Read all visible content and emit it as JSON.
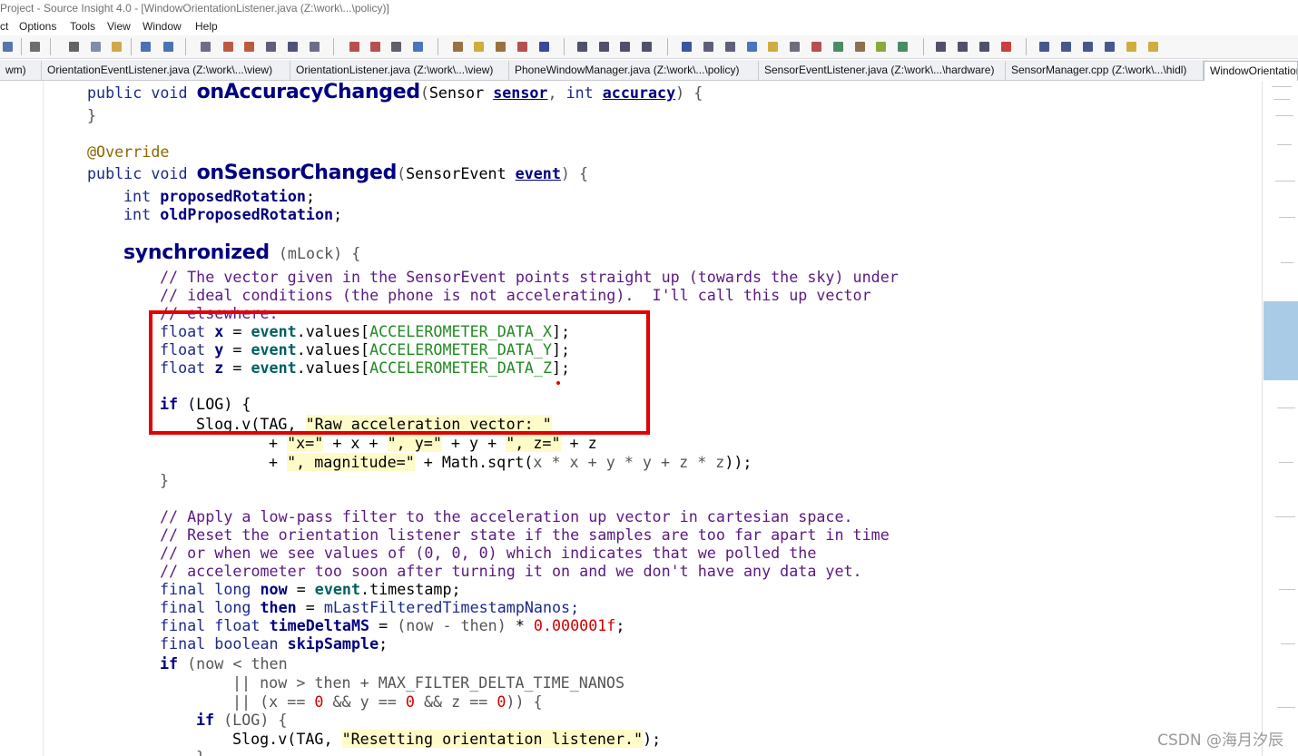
{
  "window": {
    "title": "Project - Source Insight 4.0 - [WindowOrientationListener.java (Z:\\work\\...\\policy)]"
  },
  "menu": [
    "ct",
    "Options",
    "Tools",
    "View",
    "Window",
    "Help"
  ],
  "tabs": [
    "wm)",
    "OrientationEventListener.java (Z:\\work\\...\\view)",
    "OrientationListener.java (Z:\\work\\...\\view)",
    "PhoneWindowManager.java (Z:\\work\\...\\policy)",
    "SensorEventListener.java (Z:\\work\\...\\hardware)",
    "SensorManager.cpp (Z:\\work\\...\\hidl)",
    "WindowOrientationListener.java"
  ],
  "code": {
    "l1": {
      "pub": "public void",
      "name": "onAccuracyChanged",
      "open": "(",
      "t1": "Sensor",
      "a1": "sensor",
      "comma": ",",
      "t2": "int",
      "a2": "accuracy",
      "close": ") {"
    },
    "l2": "}",
    "l3": "@Override",
    "l4": {
      "pub": "public void",
      "name": "onSensorChanged",
      "open": "(",
      "t1": "SensorEvent",
      "a1": "event",
      "close": ") {"
    },
    "l5": {
      "t": "int",
      "v": "proposedRotation",
      "s": ";"
    },
    "l6": {
      "t": "int",
      "v": "oldProposedRotation",
      "s": ";"
    },
    "l7": {
      "kw": "synchronized",
      "rest": "(mLock) {"
    },
    "c1": "// The vector given in the SensorEvent points straight up (towards the sky) under",
    "c2": "// ideal conditions (the phone is not accelerating).  I'll call this up vector",
    "c3": "// elsewhere.",
    "fx": {
      "t": "float",
      "v": "x",
      "eq": "=",
      "ev": "event",
      "rest": ".values[",
      "k": "ACCELEROMETER_DATA_X",
      "end": "];"
    },
    "fy": {
      "t": "float",
      "v": "y",
      "eq": "=",
      "ev": "event",
      "rest": ".values[",
      "k": "ACCELEROMETER_DATA_Y",
      "end": "];"
    },
    "fz": {
      "t": "float",
      "v": "z",
      "eq": "=",
      "ev": "event",
      "rest": ".values[",
      "k": "ACCELEROMETER_DATA_Z",
      "end": "];"
    },
    "if1": {
      "kw": "if",
      "rest": "(LOG) {"
    },
    "log1": {
      "pre": "Slog.v(TAG, ",
      "s": "\"Raw acceleration vector: \""
    },
    "log2": {
      "p1": "+ ",
      "s1": "\"x=\"",
      "p2": " + x + ",
      "s2": "\", y=\"",
      "p3": " + y + ",
      "s3": "\", z=\"",
      "p4": " + z"
    },
    "log3": {
      "p1": "+ ",
      "s1": "\", magnitude=\"",
      "p2": " + Math.sqrt(",
      "g": "x * x + y * y + z * z",
      "p3": "));"
    },
    "close1": "}",
    "c4": "// Apply a low-pass filter to the acceleration up vector in cartesian space.",
    "c5": "// Reset the orientation listener state if the samples are too far apart in time",
    "c6": "// or when we see values of (0, 0, 0) which indicates that we polled the",
    "c7": "// accelerometer too soon after turning it on and we don't have any data yet.",
    "n1": {
      "t": "final long",
      "v": "now",
      "eq": "=",
      "ev": "event",
      "rest": ".timestamp;"
    },
    "n2": {
      "t": "final long",
      "v": "then",
      "eq": "=",
      "rest": "mLastFilteredTimestampNanos;"
    },
    "n3": {
      "t": "final float",
      "v": "timeDeltaMS",
      "eq": "=",
      "g": "(now - then)",
      "rest": " * ",
      "num": "0.000001f",
      "end": ";"
    },
    "n4": {
      "t": "final boolean",
      "v": "skipSample",
      "end": ";"
    },
    "if2": {
      "kw": "if",
      "g": "(now < then"
    },
    "or1": "|| now > then + MAX_FILTER_DELTA_TIME_NANOS",
    "or2": {
      "g1": "|| (x == ",
      "n1": "0",
      "g2": " && y == ",
      "n2": "0",
      "g3": " && z == ",
      "n3": "0",
      "g4": ")) {"
    },
    "if3": {
      "kw": "if",
      "rest": "(LOG) {"
    },
    "log4": {
      "pre": "Slog.v(TAG, ",
      "s": "\"Resetting orientation listener.\"",
      "end": ");"
    },
    "close2": "}"
  },
  "watermark": "CSDN @海月汐辰",
  "colors": {
    "highlight_box": "#e30000",
    "minimap_view": "#aacbe6"
  }
}
